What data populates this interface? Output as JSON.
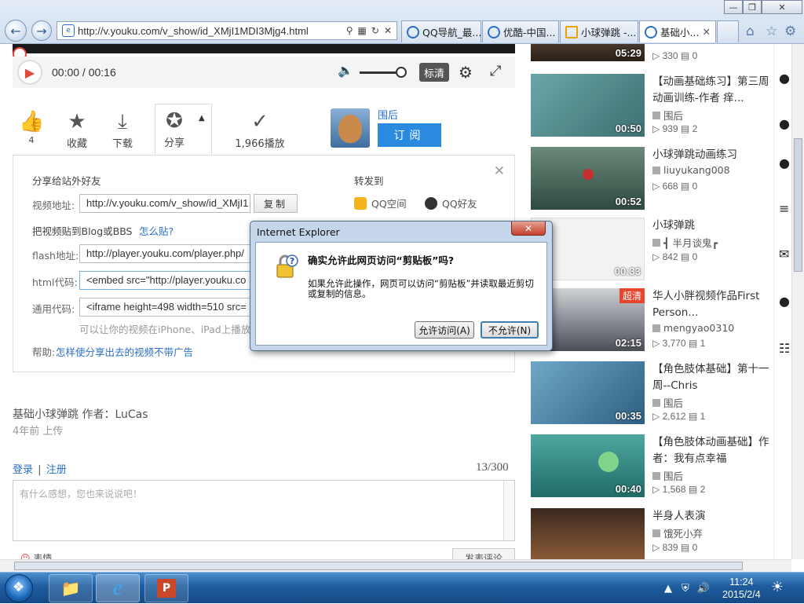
{
  "browser": {
    "url": "http://v.youku.com/v_show/id_XMjI1MDI3Mjg4.html",
    "tabs": [
      {
        "label": "QQ导航_最..."
      },
      {
        "label": "优酷-中国..."
      },
      {
        "label": "小球弹跳 -..."
      },
      {
        "label": "基础小..."
      }
    ]
  },
  "player": {
    "time": "00:00 / 00:16",
    "quality": "标清"
  },
  "actions": {
    "like_count": "4",
    "collect": "收藏",
    "download": "下载",
    "share": "分享",
    "plays": "1,966播放"
  },
  "uploader": {
    "name": "围后",
    "subscribe": "订阅"
  },
  "share": {
    "heading": "分享给站外好友",
    "video_url_label": "视频地址:",
    "video_url": "http://v.youku.com/v_show/id_XMjI1",
    "copy": "复制",
    "blog_label": "把视频贴到Blog或BBS",
    "how_to": "怎么贴?",
    "flash_label": "flash地址:",
    "flash_value": "http://player.youku.com/player.php/",
    "html_label": "html代码:",
    "html_value": "<embed src=\"http://player.youku.co",
    "generic_label": "通用代码:",
    "generic_value": "<iframe height=498 width=510 src=",
    "hint": "可以让你的视频在iPhone、iPad上播放！",
    "help_label": "帮助:",
    "help_link": "怎样使分享出去的视频不带广告",
    "forward_to": "转发到",
    "dest_qzone": "QQ空间",
    "dest_qqfriend": "QQ好友"
  },
  "video": {
    "title": "基础小球弹跳 作者：LuCas",
    "uploaded": "4年前 上传"
  },
  "comments": {
    "login": "登录",
    "sep": "|",
    "register": "注册",
    "count": "13/300",
    "placeholder": "有什么感想，您也来说说吧！",
    "emoji": "表情",
    "submit": "发表评论"
  },
  "recommendations": [
    {
      "duration": "05:29",
      "title": "",
      "author": "",
      "plays": "330",
      "comments": "0"
    },
    {
      "duration": "00:50",
      "title": "【动画基础练习】第三周动画训练-作者 痒...",
      "author": "围后",
      "plays": "939",
      "comments": "2"
    },
    {
      "duration": "00:52",
      "title": "小球弹跳动画练习",
      "author": "liuyukang008",
      "plays": "668",
      "comments": "0"
    },
    {
      "duration": "00:33",
      "title": "小球弹跳",
      "author": "┫ 半月谈鬼┏",
      "plays": "842",
      "comments": "0"
    },
    {
      "duration": "02:15",
      "badge": "超清",
      "title": "华人小胖视频作品First Person...",
      "author": "mengyao0310",
      "plays": "3,770",
      "comments": "1"
    },
    {
      "duration": "00:35",
      "title": "【角色肢体基础】第十一周--Chris",
      "author": "围后",
      "plays": "2,612",
      "comments": "1"
    },
    {
      "duration": "00:40",
      "title": "【角色肢体动画基础】作者：我有点幸福",
      "author": "围后",
      "plays": "1,568",
      "comments": "2"
    },
    {
      "duration": "",
      "title": "半身人表演",
      "author": "饿死小弃",
      "plays": "839",
      "comments": "0"
    }
  ],
  "dialog": {
    "title": "Internet Explorer",
    "question": "确实允许此网页访问“剪贴板”吗?",
    "description": "如果允许此操作，网页可以访问“剪贴板”并读取最近剪切或复制的信息。",
    "allow": "允许访问(A)",
    "deny": "不允许(N)"
  },
  "taskbar": {
    "time": "11:24",
    "date": "2015/2/4"
  },
  "colors": {
    "accent": "#2a8ae0",
    "link": "#2a6fc7",
    "play_red": "#e0463a",
    "badge_red": "#e8452d"
  }
}
